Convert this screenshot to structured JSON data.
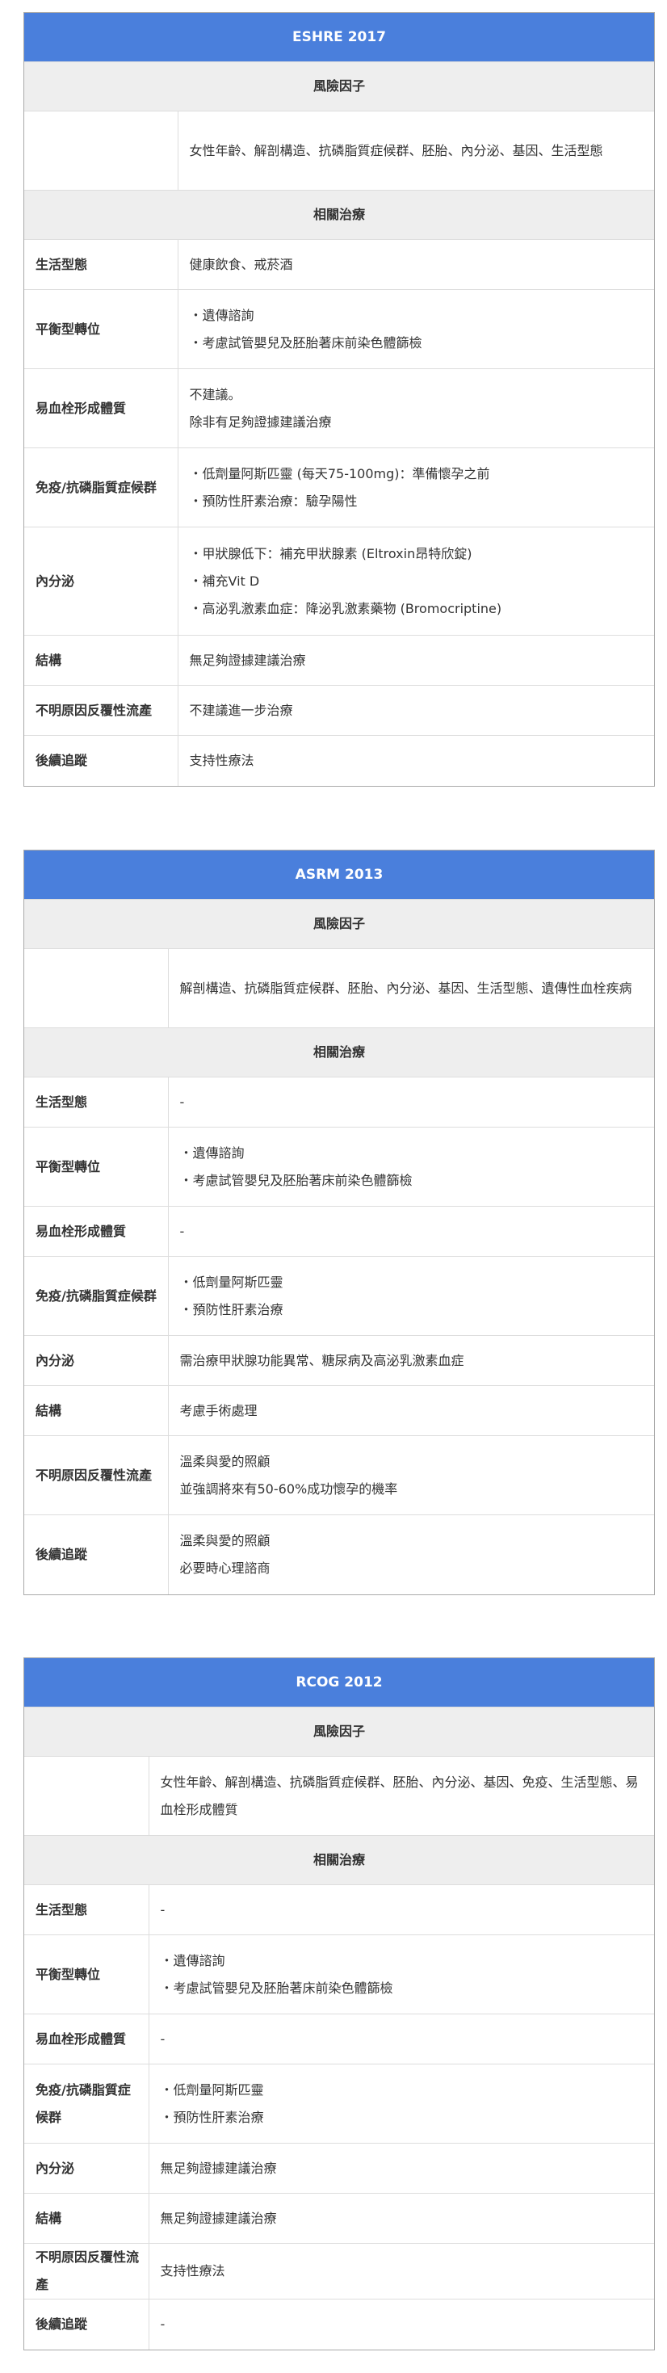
{
  "tables": [
    {
      "id": "eshre",
      "title": "ESHRE 2017",
      "risk_header": "風險因子",
      "risk_factors": "女性年齡、解剖構造、抗磷脂質症候群、胚胎、內分泌、基因、生活型態",
      "treatment_header": "相關治療",
      "rows": [
        {
          "label": "生活型態",
          "lines": [
            "健康飲食、戒菸酒"
          ]
        },
        {
          "label": "平衡型轉位",
          "lines": [
            "・遺傳諮詢",
            "・考慮試管嬰兒及胚胎著床前染色體篩檢"
          ]
        },
        {
          "label": "易血栓形成體質",
          "lines": [
            "不建議。",
            "除非有足夠證據建議治療"
          ]
        },
        {
          "label": "免疫/抗磷脂質症候群",
          "lines": [
            "・低劑量阿斯匹靈 (每天75-100mg)：準備懷孕之前",
            "・預防性肝素治療：驗孕陽性"
          ]
        },
        {
          "label": "內分泌",
          "lines": [
            "・甲狀腺低下：補充甲狀腺素 (Eltroxin昂特欣錠)",
            "・補充Vit D",
            "・高泌乳激素血症：降泌乳激素藥物 (Bromocriptine)"
          ]
        },
        {
          "label": "結構",
          "lines": [
            "無足夠證據建議治療"
          ]
        },
        {
          "label": "不明原因反覆性流產",
          "lines": [
            "不建議進一步治療"
          ]
        },
        {
          "label": "後續追蹤",
          "lines": [
            "支持性療法"
          ]
        }
      ]
    },
    {
      "id": "asrm",
      "title": "ASRM 2013",
      "risk_header": "風險因子",
      "risk_factors": "解剖構造、抗磷脂質症候群、胚胎、內分泌、基因、生活型態、遺傳性血栓疾病",
      "treatment_header": "相關治療",
      "rows": [
        {
          "label": "生活型態",
          "lines": [
            "-"
          ]
        },
        {
          "label": "平衡型轉位",
          "lines": [
            "・遺傳諮詢",
            "・考慮試管嬰兒及胚胎著床前染色體篩檢"
          ]
        },
        {
          "label": "易血栓形成體質",
          "lines": [
            "-"
          ]
        },
        {
          "label": "免疫/抗磷脂質症候群",
          "lines": [
            "・低劑量阿斯匹靈",
            "・預防性肝素治療"
          ]
        },
        {
          "label": "內分泌",
          "lines": [
            "需治療甲狀腺功能異常、糖尿病及高泌乳激素血症"
          ]
        },
        {
          "label": "結構",
          "lines": [
            "考慮手術處理"
          ]
        },
        {
          "label": "不明原因反覆性流產",
          "lines": [
            "溫柔與愛的照顧",
            "並強調將來有50-60%成功懷孕的機率"
          ]
        },
        {
          "label": "後續追蹤",
          "lines": [
            "溫柔與愛的照顧",
            "必要時心理諮商"
          ]
        }
      ]
    },
    {
      "id": "rcog",
      "title": "RCOG 2012",
      "risk_header": "風險因子",
      "risk_factors": "女性年齡、解剖構造、抗磷脂質症候群、胚胎、內分泌、基因、免疫、生活型態、易血栓形成體質",
      "treatment_header": "相關治療",
      "rows": [
        {
          "label": "生活型態",
          "lines": [
            "-"
          ]
        },
        {
          "label": "平衡型轉位",
          "lines": [
            "・遺傳諮詢",
            "・考慮試管嬰兒及胚胎著床前染色體篩檢"
          ]
        },
        {
          "label": "易血栓形成體質",
          "lines": [
            "-"
          ]
        },
        {
          "label": "免疫/抗磷脂質症候群",
          "lines": [
            "・低劑量阿斯匹靈",
            "・預防性肝素治療"
          ]
        },
        {
          "label": "內分泌",
          "lines": [
            "無足夠證據建議治療"
          ]
        },
        {
          "label": "結構",
          "lines": [
            "無足夠證據建議治療"
          ]
        },
        {
          "label": "不明原因反覆性流產",
          "lines": [
            "支持性療法"
          ]
        },
        {
          "label": "後續追蹤",
          "lines": [
            "-"
          ]
        }
      ]
    }
  ]
}
